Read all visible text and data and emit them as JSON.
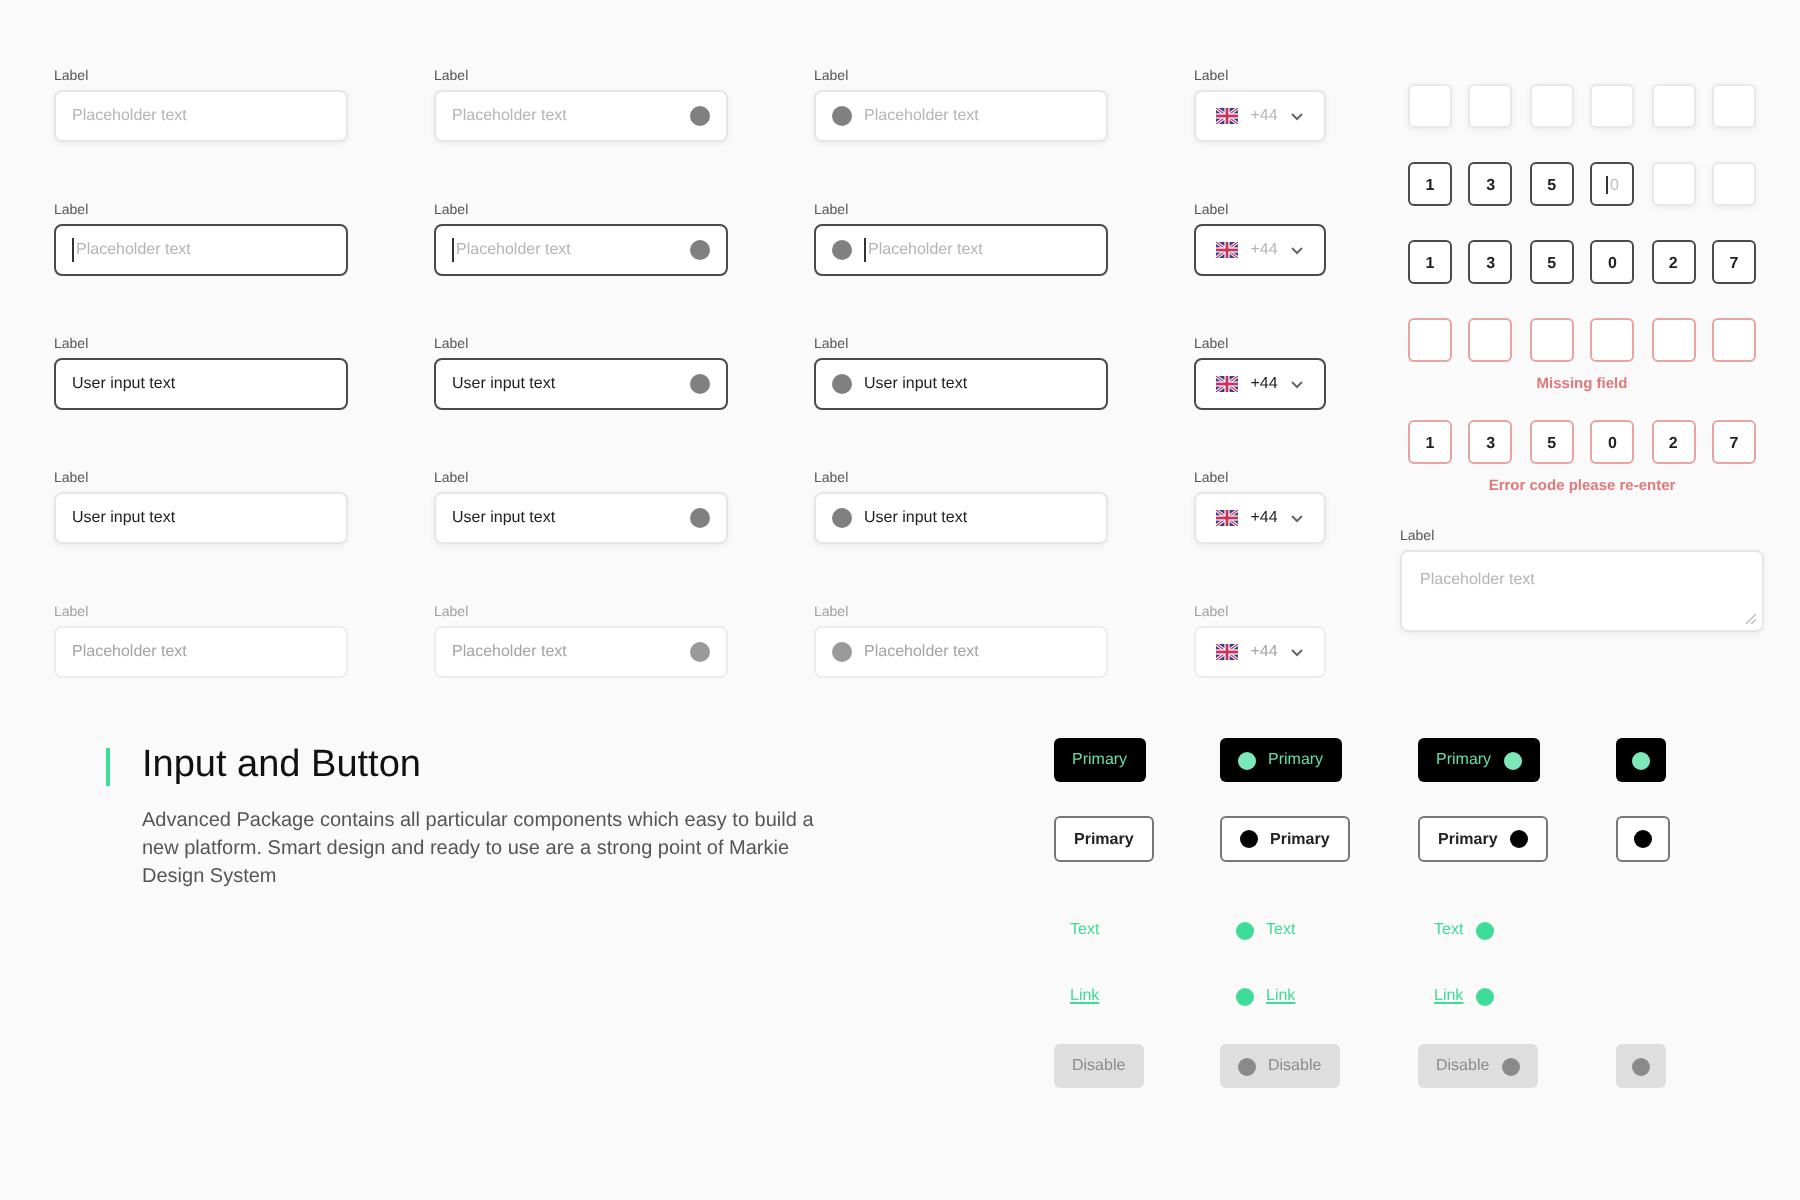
{
  "input_rows": [
    {
      "focused": false,
      "disabled": false,
      "fields": [
        {
          "kind": "plain",
          "label": "Label",
          "placeholder": "Placeholder text"
        },
        {
          "kind": "icon_right",
          "label": "Label",
          "placeholder": "Placeholder text"
        },
        {
          "kind": "icon_left",
          "label": "Label",
          "placeholder": "Placeholder text"
        },
        {
          "kind": "phone",
          "label": "Label",
          "placeholder": "+44"
        }
      ]
    },
    {
      "focused": true,
      "disabled": false,
      "fields": [
        {
          "kind": "plain",
          "label": "Label",
          "placeholder": "Placeholder text"
        },
        {
          "kind": "icon_right",
          "label": "Label",
          "placeholder": "Placeholder text"
        },
        {
          "kind": "icon_left",
          "label": "Label",
          "placeholder": "Placeholder text"
        },
        {
          "kind": "phone",
          "label": "Label",
          "placeholder": "+44"
        }
      ]
    },
    {
      "focused": true,
      "disabled": false,
      "fields": [
        {
          "kind": "plain",
          "label": "Label",
          "value": "User input text"
        },
        {
          "kind": "icon_right",
          "label": "Label",
          "value": "User input text"
        },
        {
          "kind": "icon_left",
          "label": "Label",
          "value": "User input text"
        },
        {
          "kind": "phone",
          "label": "Label",
          "value": "+44"
        }
      ]
    },
    {
      "focused": false,
      "disabled": false,
      "fields": [
        {
          "kind": "plain",
          "label": "Label",
          "value": "User input text"
        },
        {
          "kind": "icon_right",
          "label": "Label",
          "value": "User input text"
        },
        {
          "kind": "icon_left",
          "label": "Label",
          "value": "User input text"
        },
        {
          "kind": "phone",
          "label": "Label",
          "value": "+44"
        }
      ]
    },
    {
      "focused": false,
      "disabled": true,
      "fields": [
        {
          "kind": "plain",
          "label": "Label",
          "placeholder": "Placeholder text"
        },
        {
          "kind": "icon_right",
          "label": "Label",
          "placeholder": "Placeholder text"
        },
        {
          "kind": "icon_left",
          "label": "Label",
          "placeholder": "Placeholder text"
        },
        {
          "kind": "phone",
          "label": "Label",
          "placeholder": "+44"
        }
      ]
    }
  ],
  "code_rows": [
    {
      "error": false,
      "cells": [
        {
          "focused": false
        },
        {
          "focused": false
        },
        {
          "focused": false
        },
        {
          "focused": false
        },
        {
          "focused": false
        },
        {
          "focused": false
        }
      ]
    },
    {
      "error": false,
      "cells": [
        {
          "value": "1",
          "focused": false
        },
        {
          "value": "3",
          "focused": false
        },
        {
          "value": "5",
          "focused": false
        },
        {
          "placeholder": "0",
          "focused": true
        },
        {
          "focused": false
        },
        {
          "focused": false
        }
      ]
    },
    {
      "error": false,
      "cells": [
        {
          "value": "1",
          "focused": false
        },
        {
          "value": "3",
          "focused": false
        },
        {
          "value": "5",
          "focused": false
        },
        {
          "value": "0",
          "focused": false
        },
        {
          "value": "2",
          "focused": false
        },
        {
          "value": "7",
          "focused": false
        }
      ]
    },
    {
      "error": true,
      "message": "Missing field",
      "cells": [
        {
          "focused": false
        },
        {
          "focused": false
        },
        {
          "focused": false
        },
        {
          "focused": false
        },
        {
          "focused": false
        },
        {
          "focused": false
        }
      ]
    },
    {
      "error": true,
      "message": "Error code please re-enter",
      "cells": [
        {
          "value": "1",
          "focused": false
        },
        {
          "value": "3",
          "focused": false
        },
        {
          "value": "5",
          "focused": false
        },
        {
          "value": "0",
          "focused": false
        },
        {
          "value": "2",
          "focused": false
        },
        {
          "value": "7",
          "focused": false
        }
      ]
    }
  ],
  "textarea": {
    "label": "Label",
    "placeholder": "Placeholder text"
  },
  "section": {
    "title": "Input and Button",
    "description": "Advanced Package contains all particular components which easy to build a new platform. Smart design and ready to use are a strong point of Markie Design System"
  },
  "button_rows": [
    {
      "kind": "solid",
      "buttons": [
        {
          "kind": "plain",
          "label": "Primary"
        },
        {
          "kind": "leading",
          "label": "Primary"
        },
        {
          "kind": "trailing",
          "label": "Primary"
        },
        {
          "kind": "iconic"
        }
      ]
    },
    {
      "kind": "outline",
      "buttons": [
        {
          "kind": "plain",
          "label": "Primary"
        },
        {
          "kind": "leading",
          "label": "Primary"
        },
        {
          "kind": "trailing",
          "label": "Primary"
        },
        {
          "kind": "iconic"
        }
      ]
    },
    {
      "kind": "text",
      "buttons": [
        {
          "kind": "plain",
          "label": "Text"
        },
        {
          "kind": "leading",
          "label": "Text"
        },
        {
          "kind": "trailing",
          "label": "Text"
        }
      ]
    },
    {
      "kind": "link",
      "buttons": [
        {
          "kind": "plain",
          "label": "Link"
        },
        {
          "kind": "leading",
          "label": "Link"
        },
        {
          "kind": "trailing",
          "label": "Link"
        }
      ]
    },
    {
      "kind": "disabled",
      "buttons": [
        {
          "kind": "plain",
          "label": "Disable"
        },
        {
          "kind": "leading",
          "label": "Disable"
        },
        {
          "kind": "trailing",
          "label": "Disable"
        },
        {
          "kind": "iconic"
        }
      ]
    }
  ]
}
